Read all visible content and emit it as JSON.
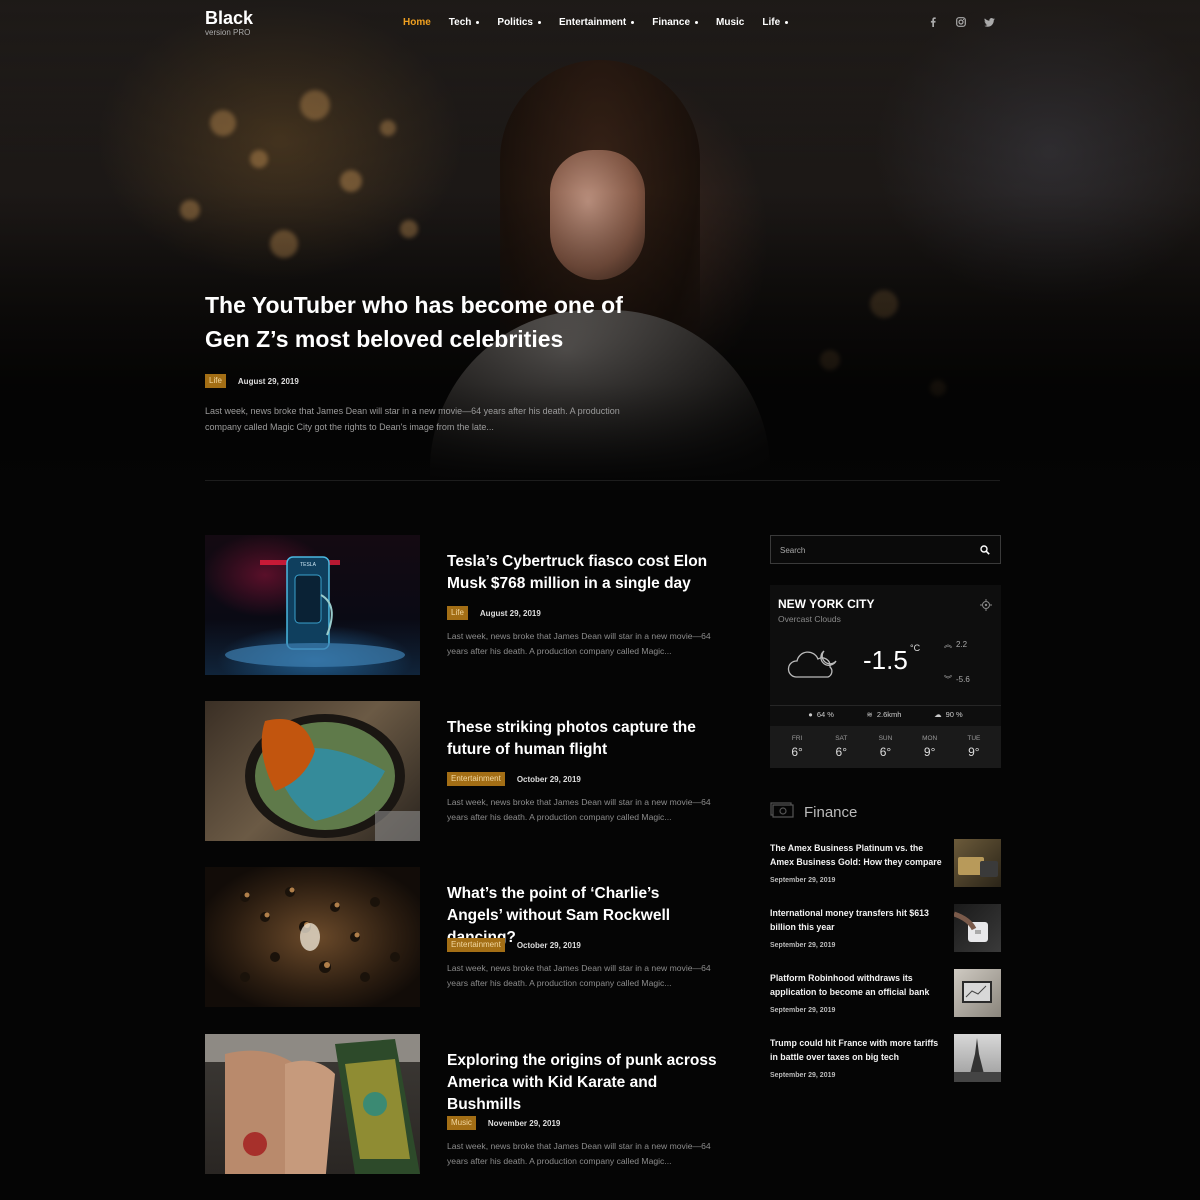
{
  "brand": {
    "name": "Black",
    "tagline": "version PRO"
  },
  "nav": {
    "items": [
      {
        "label": "Home",
        "active": true,
        "dropdown": false
      },
      {
        "label": "Tech",
        "active": false,
        "dropdown": true
      },
      {
        "label": "Politics",
        "active": false,
        "dropdown": true
      },
      {
        "label": "Entertainment",
        "active": false,
        "dropdown": true
      },
      {
        "label": "Finance",
        "active": false,
        "dropdown": true
      },
      {
        "label": "Music",
        "active": false,
        "dropdown": false
      },
      {
        "label": "Life",
        "active": false,
        "dropdown": true
      }
    ],
    "social": [
      "facebook-icon",
      "instagram-icon",
      "twitter-icon"
    ]
  },
  "hero": {
    "title": "The YouTuber who has become one of Gen Z’s most beloved celebrities",
    "category": "Life",
    "date": "August 29, 2019",
    "excerpt": "Last week, news broke that James Dean will star in a new movie—64 years after his death. A production company called Magic City got the rights to Dean's image from the late..."
  },
  "articles": [
    {
      "title": "Tesla’s Cybertruck fiasco cost Elon Musk $768 million in a single day",
      "category": "Life",
      "date": "August 29, 2019",
      "excerpt": "Last week, news broke that James Dean will star in a new movie—64 years after his death. A production company called Magic...",
      "thumb_word": "TESLA"
    },
    {
      "title": "These striking photos capture the future of human flight",
      "category": "Entertainment",
      "date": "October 29, 2019",
      "excerpt": "Last week, news broke that James Dean will star in a new movie—64 years after his death. A production company called Magic..."
    },
    {
      "title": "What’s the point of ‘Charlie’s Angels’ without Sam Rockwell dancing?",
      "category": "Entertainment",
      "date": "October 29, 2019",
      "excerpt": "Last week, news broke that James Dean will star in a new movie—64 years after his death. A production company called Magic..."
    },
    {
      "title": "Exploring the origins of punk across America with Kid Karate and Bushmills",
      "category": "Music",
      "date": "November 29, 2019",
      "excerpt": "Last week, news broke that James Dean will star in a new movie—64 years after his death. A production company called Magic..."
    }
  ],
  "search": {
    "placeholder": "Search"
  },
  "weather": {
    "city": "NEW YORK CITY",
    "condition": "Overcast Clouds",
    "temp": "-1.5",
    "unit": "°C",
    "high": "2.2",
    "low": "-5.6",
    "humidity": "64 %",
    "wind": "2.6kmh",
    "clouds": "90 %",
    "forecast": [
      {
        "day": "FRI",
        "temp": "6°"
      },
      {
        "day": "SAT",
        "temp": "6°"
      },
      {
        "day": "SUN",
        "temp": "6°"
      },
      {
        "day": "MON",
        "temp": "9°"
      },
      {
        "day": "TUE",
        "temp": "9°"
      }
    ]
  },
  "finance": {
    "title": "Finance",
    "items": [
      {
        "title": "The Amex Business Platinum vs. the Amex Business Gold: How they compare",
        "date": "September 29, 2019"
      },
      {
        "title": "International money transfers hit $613 billion this year",
        "date": "September 29, 2019"
      },
      {
        "title": "Platform Robinhood withdraws its application to become an official bank",
        "date": "September 29, 2019"
      },
      {
        "title": "Trump could hit France with more tariffs in battle over taxes on big tech",
        "date": "September 29, 2019"
      }
    ]
  },
  "colors": {
    "accent": "#f0a020",
    "tag_bg": "#a36e15",
    "background": "#050505"
  }
}
